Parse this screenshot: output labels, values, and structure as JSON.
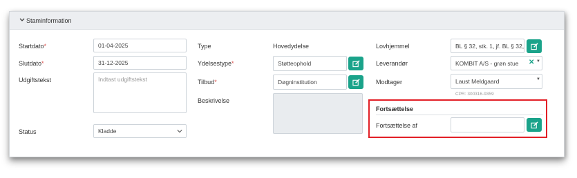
{
  "panel": {
    "title": "Staminformation"
  },
  "col1": {
    "startdato": {
      "label": "Startdato",
      "required_mark": "*",
      "value": "01-04-2025"
    },
    "slutdato": {
      "label": "Slutdato",
      "required_mark": "*",
      "value": "31-12-2025"
    },
    "udgiftstekst": {
      "label": "Udgiftstekst",
      "placeholder": "Indtast udgiftstekst"
    },
    "status": {
      "label": "Status",
      "value": "Kladde"
    }
  },
  "col2": {
    "type": {
      "label": "Type",
      "value": "Hovedydelse"
    },
    "ydelsestype": {
      "label": "Ydelsestype",
      "required_mark": "*",
      "value": "Støtteophold"
    },
    "tilbud": {
      "label": "Tilbud",
      "required_mark": "*",
      "value": "Døgninstitution"
    },
    "beskrivelse": {
      "label": "Beskrivelse"
    }
  },
  "col3": {
    "lovhjemmel": {
      "label": "Lovhjemmel",
      "value": "BL § 32, stk. 1, jf. BL § 32, s"
    },
    "leverandor": {
      "label": "Leverandør",
      "value": "KOMBIT A/S - grøn stue"
    },
    "modtager": {
      "label": "Modtager",
      "value": "Laust Meldgaard",
      "cpr": "CPR: 300316-9359"
    },
    "fortsaettelse": {
      "heading": "Fortsættelse",
      "label": "Fortsættelse af",
      "value": ""
    }
  },
  "colors": {
    "accent": "#1aa38a",
    "highlight": "#e21f26",
    "required": "#d9534f"
  },
  "icons": {
    "collapse": "chevron-down-icon",
    "edit": "edit-icon",
    "clear": "clear-x-icon",
    "dropdown": "caret-down-icon"
  }
}
